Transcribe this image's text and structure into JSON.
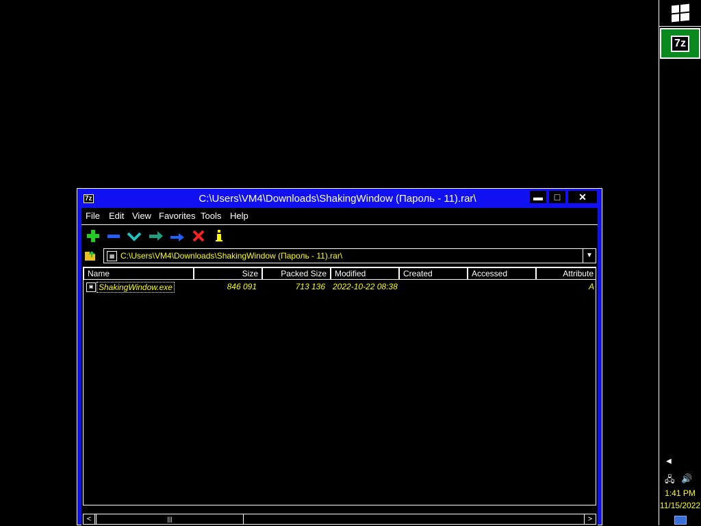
{
  "window": {
    "title": "C:\\Users\\VM4\\Downloads\\ShakingWindow (Пароль - 11).rar\\",
    "app_icon": "7z"
  },
  "menubar": {
    "items": [
      "File",
      "Edit",
      "View",
      "Favorites",
      "Tools",
      "Help"
    ]
  },
  "toolbar": {
    "buttons": [
      {
        "name": "add",
        "icon": "plus-icon",
        "color": "#22cc22"
      },
      {
        "name": "delete",
        "icon": "minus-icon",
        "color": "#2060ff"
      },
      {
        "name": "extract",
        "icon": "check-icon",
        "color": "#20c0c0"
      },
      {
        "name": "copy",
        "icon": "arrow-right-icon",
        "color": "#20a080"
      },
      {
        "name": "move",
        "icon": "arrow-right-icon",
        "color": "#2060ff"
      },
      {
        "name": "delete-file",
        "icon": "x-icon",
        "color": "#ff2020"
      },
      {
        "name": "info",
        "icon": "info-icon",
        "color": "#ffff00"
      }
    ]
  },
  "address": {
    "path": "C:\\Users\\VM4\\Downloads\\ShakingWindow (Пароль - 11).rar\\"
  },
  "list": {
    "columns": [
      "Name",
      "Size",
      "Packed Size",
      "Modified",
      "Created",
      "Accessed",
      "Attribute"
    ],
    "rows": [
      {
        "name": "ShakingWindow.exe",
        "size": "846 091",
        "packed": "713 136",
        "modified": "2022-10-22 08:38",
        "created": "",
        "accessed": "",
        "attribute": "A"
      }
    ]
  },
  "taskbar": {
    "time": "1:41 PM",
    "date": "11/15/2022",
    "app_label": "7z",
    "accent": "#0a8a1e"
  },
  "colors": {
    "window_frame": "#1010f0",
    "text_highlight": "#ffff00"
  }
}
